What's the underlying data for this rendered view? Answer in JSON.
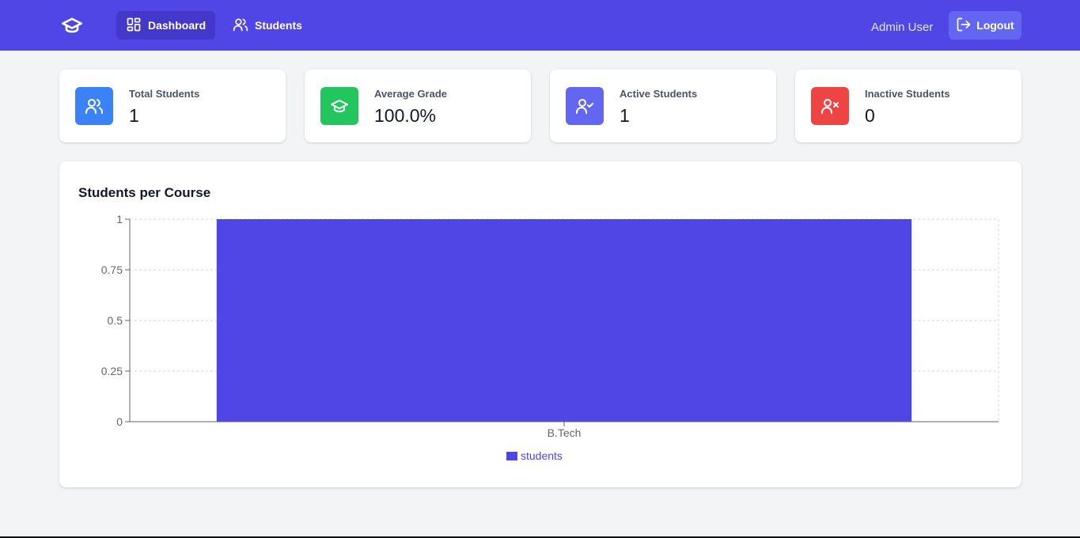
{
  "nav": {
    "items": [
      {
        "label": "Dashboard",
        "icon": "dashboard-grid-icon",
        "active": true
      },
      {
        "label": "Students",
        "icon": "users-icon",
        "active": false
      }
    ],
    "user_name": "Admin User",
    "logout_label": "Logout",
    "colors": {
      "bar": "#4f46e5",
      "active_item": "#4338ca",
      "logout": "#6366f1"
    }
  },
  "stats": [
    {
      "label": "Total Students",
      "value": "1",
      "icon": "users-icon",
      "color": "#3b82f6"
    },
    {
      "label": "Average Grade",
      "value": "100.0%",
      "icon": "graduation-cap-icon",
      "color": "#22c55e"
    },
    {
      "label": "Active Students",
      "value": "1",
      "icon": "user-check-icon",
      "color": "#6366f1"
    },
    {
      "label": "Inactive Students",
      "value": "0",
      "icon": "user-x-icon",
      "color": "#ef4444"
    }
  ],
  "panel": {
    "title": "Students per Course"
  },
  "chart_data": {
    "type": "bar",
    "categories": [
      "B.Tech"
    ],
    "series": [
      {
        "name": "students",
        "values": [
          1
        ],
        "color": "#4f46e5"
      }
    ],
    "yticks": [
      "0",
      "0.25",
      "0.5",
      "0.75",
      "1"
    ],
    "ylim": [
      0,
      1
    ],
    "grid": true,
    "legend": "bottom"
  }
}
